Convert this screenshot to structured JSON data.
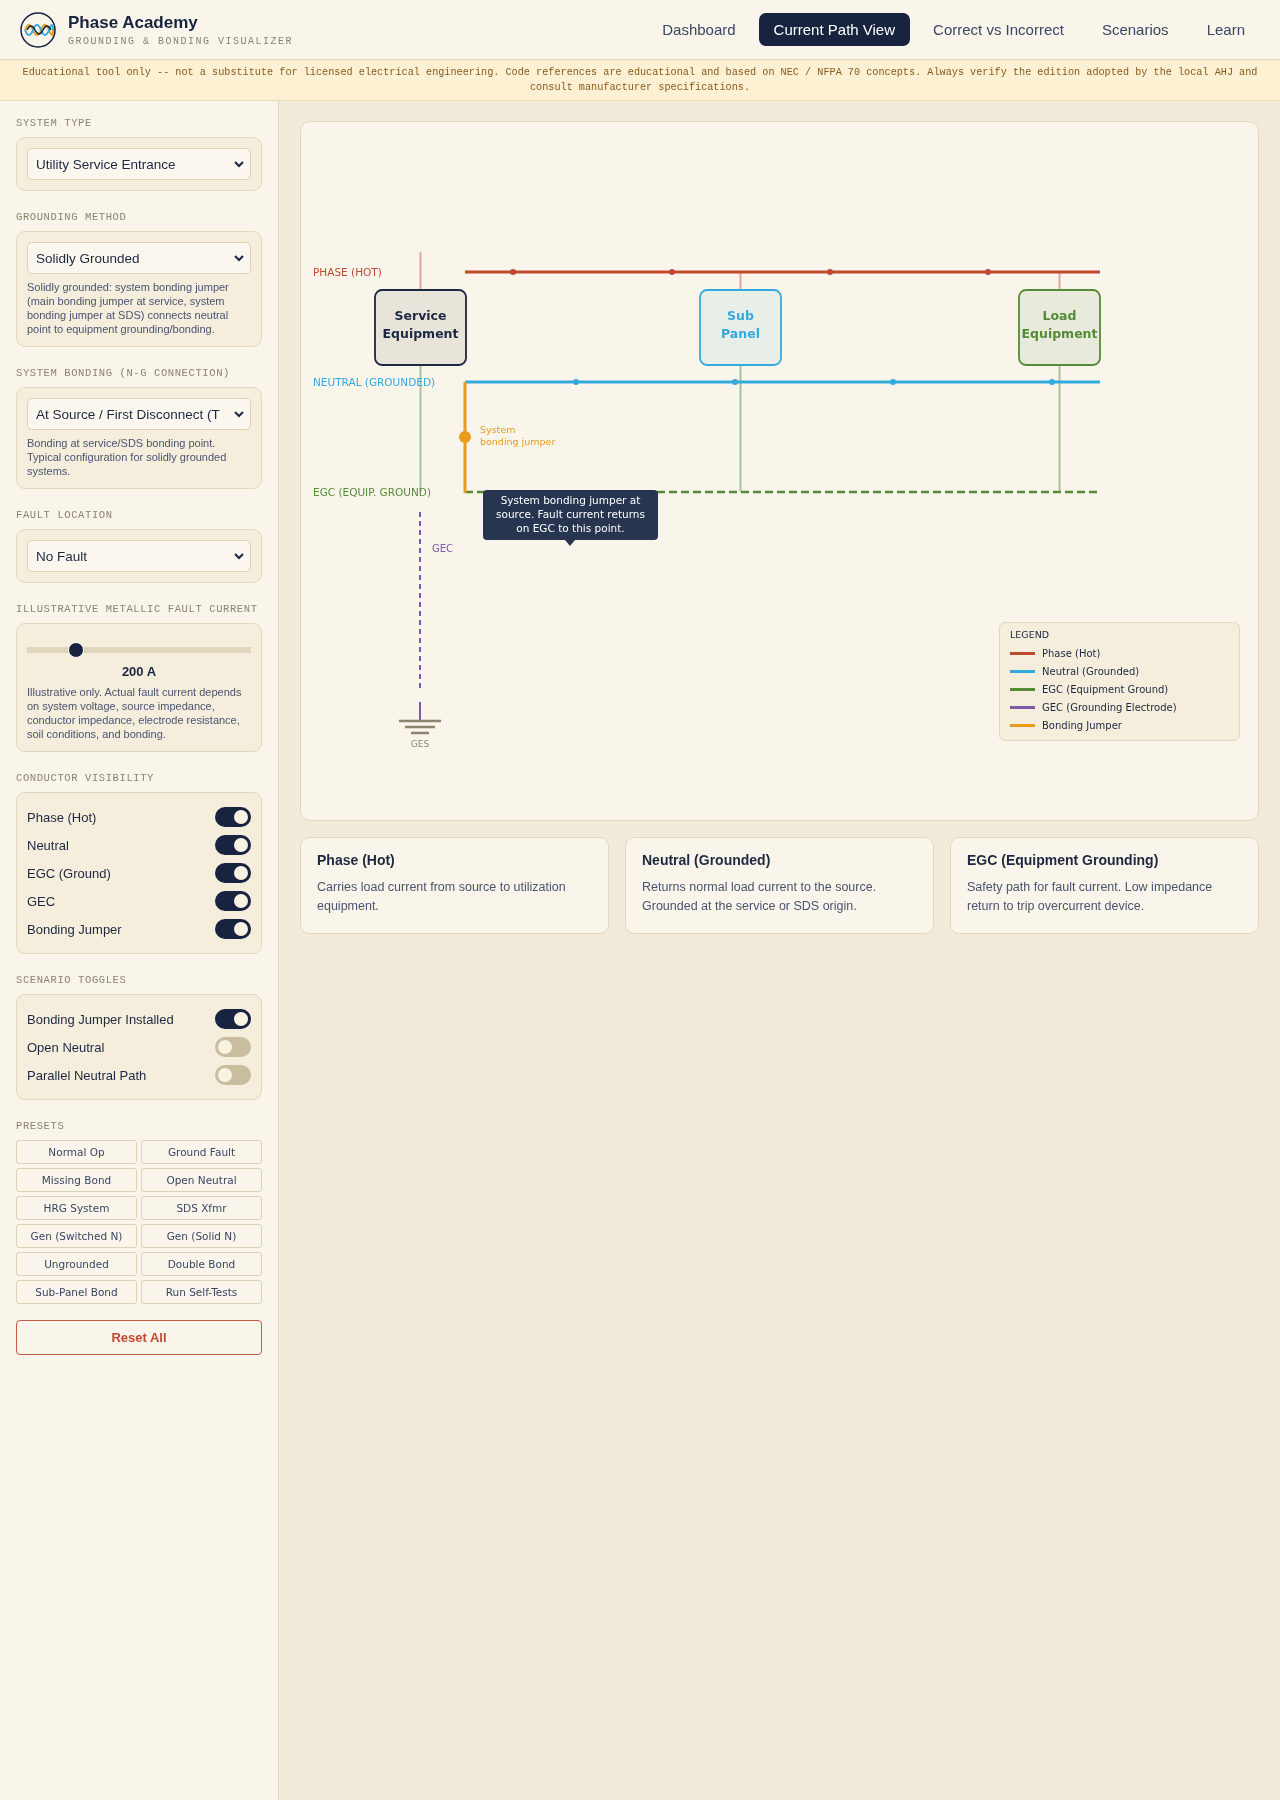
{
  "header": {
    "title": "Phase Academy",
    "subtitle": "GROUNDING & BONDING VISUALIZER",
    "nav": [
      {
        "label": "Dashboard",
        "selected": false
      },
      {
        "label": "Current Path View",
        "selected": true
      },
      {
        "label": "Correct vs Incorrect",
        "selected": false
      },
      {
        "label": "Scenarios",
        "selected": false
      },
      {
        "label": "Learn",
        "selected": false
      }
    ]
  },
  "banner": "Educational tool only -- not a substitute for licensed electrical engineering. Code references are educational and based on NEC / NFPA 70 concepts. Always verify the edition adopted by the local AHJ and consult manufacturer specifications.",
  "sidebar": {
    "sections": [
      {
        "kind": "select",
        "label": "SYSTEM TYPE",
        "value": "Utility Service Entrance"
      },
      {
        "kind": "select",
        "label": "GROUNDING METHOD",
        "value": "Solidly Grounded",
        "help": "Solidly grounded: system bonding jumper (main bonding jumper at service, system bonding jumper at SDS) connects neutral point to equipment grounding/bonding."
      },
      {
        "kind": "select",
        "label": "SYSTEM BONDING (N-G CONNECTION)",
        "value": "At Source / First Disconnect (T",
        "help": "Bonding at service/SDS bonding point. Typical configuration for solidly grounded systems."
      },
      {
        "kind": "select",
        "label": "FAULT LOCATION",
        "value": "No Fault"
      },
      {
        "kind": "slider",
        "label": "ILLUSTRATIVE METALLIC FAULT CURRENT",
        "level": 0.22,
        "reading": "200 A",
        "help": "Illustrative only. Actual fault current depends on system voltage, source impedance, conductor impedance, electrode resistance, soil conditions, and bonding."
      },
      {
        "kind": "toggles",
        "label": "CONDUCTOR VISIBILITY",
        "items": [
          {
            "label": "Phase (Hot)",
            "on": true
          },
          {
            "label": "Neutral",
            "on": true
          },
          {
            "label": "EGC (Ground)",
            "on": true
          },
          {
            "label": "GEC",
            "on": true
          },
          {
            "label": "Bonding Jumper",
            "on": true
          }
        ]
      },
      {
        "kind": "toggles",
        "label": "SCENARIO TOGGLES",
        "items": [
          {
            "label": "Bonding Jumper Installed",
            "on": true
          },
          {
            "label": "Open Neutral",
            "on": false
          },
          {
            "label": "Parallel Neutral Path",
            "on": false
          }
        ]
      },
      {
        "kind": "presets",
        "label": "PRESETS",
        "buttons": [
          "Normal Op",
          "Ground Fault",
          "Missing Bond",
          "Open Neutral",
          "HRG System",
          "SDS Xfmr",
          "Gen (Switched N)",
          "Gen (Solid N)",
          "Ungrounded",
          "Double Bond",
          "Sub-Panel Bond",
          "Run Self-Tests"
        ]
      }
    ],
    "reset_button": "Reset All"
  },
  "diagram": {
    "conductors": [
      {
        "kind": "phase",
        "label": "PHASE (HOT)"
      },
      {
        "kind": "neutral",
        "label": "NEUTRAL (GROUNDED)"
      },
      {
        "kind": "egc",
        "label": "EGC (EQUIP. GROUND)"
      }
    ],
    "equipment": [
      {
        "kind": "service",
        "label": "Service Equipment"
      },
      {
        "kind": "sub",
        "label": "Sub Panel"
      },
      {
        "kind": "load",
        "label": "Load Equipment"
      }
    ],
    "bonding_label": "System bonding jumper",
    "tooltip": "System bonding jumper at source. Fault current returns on EGC to this point.",
    "gec_label": "GEC",
    "ges_label": "GES",
    "legend": {
      "title": "LEGEND",
      "items": [
        {
          "label": "Phase (Hot)",
          "color": "#c0492f"
        },
        {
          "label": "Neutral (Grounded)",
          "color": "#34a9dd"
        },
        {
          "label": "EGC (Equipment Ground)",
          "color": "#558b36"
        },
        {
          "label": "GEC (Grounding Electrode)",
          "color": "#7b5aa6"
        },
        {
          "label": "Bonding Jumper",
          "color": "#e89b1c"
        }
      ]
    }
  },
  "cards": [
    {
      "title": "Phase (Hot)",
      "text": "Carries load current from source to utilization equipment."
    },
    {
      "title": "Neutral (Grounded)",
      "text": "Returns normal load current to the source. Grounded at the service or SDS origin."
    },
    {
      "title": "EGC (Equipment Grounding)",
      "text": "Safety path for fault current. Low impedance return to trip overcurrent device."
    }
  ]
}
